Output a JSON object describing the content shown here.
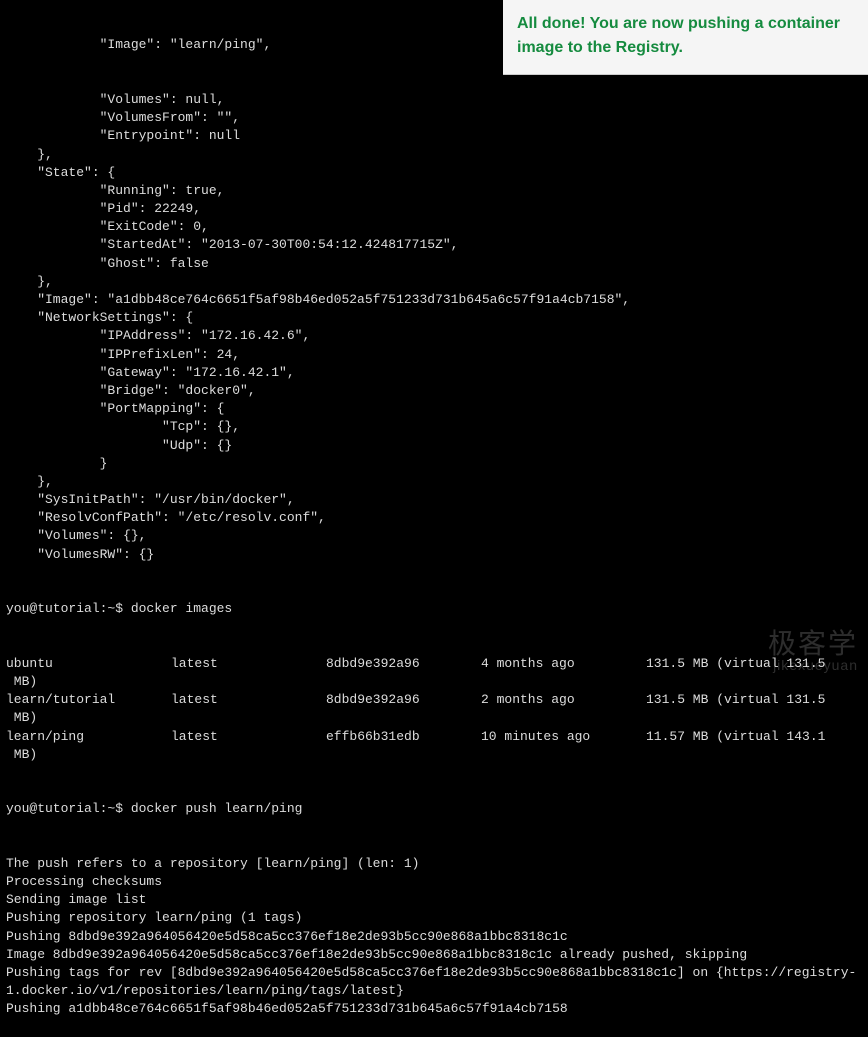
{
  "notification": {
    "text": "All done! You are now pushing a container image to the Registry."
  },
  "json_lines": [
    "            \"Volumes\": null,",
    "            \"VolumesFrom\": \"\",",
    "            \"Entrypoint\": null",
    "    },",
    "    \"State\": {",
    "            \"Running\": true,",
    "            \"Pid\": 22249,",
    "            \"ExitCode\": 0,",
    "            \"StartedAt\": \"2013-07-30T00:54:12.424817715Z\",",
    "            \"Ghost\": false",
    "    },",
    "    \"Image\": \"a1dbb48ce764c6651f5af98b46ed052a5f751233d731b645a6c57f91a4cb7158\",",
    "    \"NetworkSettings\": {",
    "            \"IPAddress\": \"172.16.42.6\",",
    "            \"IPPrefixLen\": 24,",
    "            \"Gateway\": \"172.16.42.1\",",
    "            \"Bridge\": \"docker0\",",
    "            \"PortMapping\": {",
    "                    \"Tcp\": {},",
    "                    \"Udp\": {}",
    "            }",
    "    },",
    "    \"SysInitPath\": \"/usr/bin/docker\",",
    "    \"ResolvConfPath\": \"/etc/resolv.conf\",",
    "    \"Volumes\": {},",
    "    \"VolumesRW\": {}"
  ],
  "prompt1": "you@tutorial:~$ docker images",
  "images_table": [
    {
      "repo": "ubuntu",
      "tag": "latest",
      "id": "8dbd9e392a96",
      "created": "4 months ago",
      "size": "131.5 MB (virtual 131.5"
    },
    {
      "repo": " MB)",
      "tag": "",
      "id": "",
      "created": "",
      "size": ""
    },
    {
      "repo": "learn/tutorial",
      "tag": "latest",
      "id": "8dbd9e392a96",
      "created": "2 months ago",
      "size": "131.5 MB (virtual 131.5"
    },
    {
      "repo": " MB)",
      "tag": "",
      "id": "",
      "created": "",
      "size": ""
    },
    {
      "repo": "learn/ping",
      "tag": "latest",
      "id": "effb66b31edb",
      "created": "10 minutes ago",
      "size": "11.57 MB (virtual 143.1"
    },
    {
      "repo": " MB)",
      "tag": "",
      "id": "",
      "created": "",
      "size": ""
    }
  ],
  "prompt2": "you@tutorial:~$ docker push learn/ping",
  "push_lines": [
    "The push refers to a repository [learn/ping] (len: 1)",
    "Processing checksums",
    "Sending image list",
    "Pushing repository learn/ping (1 tags)",
    "Pushing 8dbd9e392a964056420e5d58ca5cc376ef18e2de93b5cc90e868a1bbc8318c1c",
    "Image 8dbd9e392a964056420e5d58ca5cc376ef18e2de93b5cc90e868a1bbc8318c1c already pushed, skipping",
    "Pushing tags for rev [8dbd9e392a964056420e5d58ca5cc376ef18e2de93b5cc90e868a1bbc8318c1c] on {https://registry-1.docker.io/v1/repositories/learn/ping/tags/latest}",
    "Pushing a1dbb48ce764c6651f5af98b46ed052a5f751233d731b645a6c57f91a4cb7158"
  ],
  "watermark": {
    "cn": "极客学",
    "en": "jikexueyuan"
  }
}
